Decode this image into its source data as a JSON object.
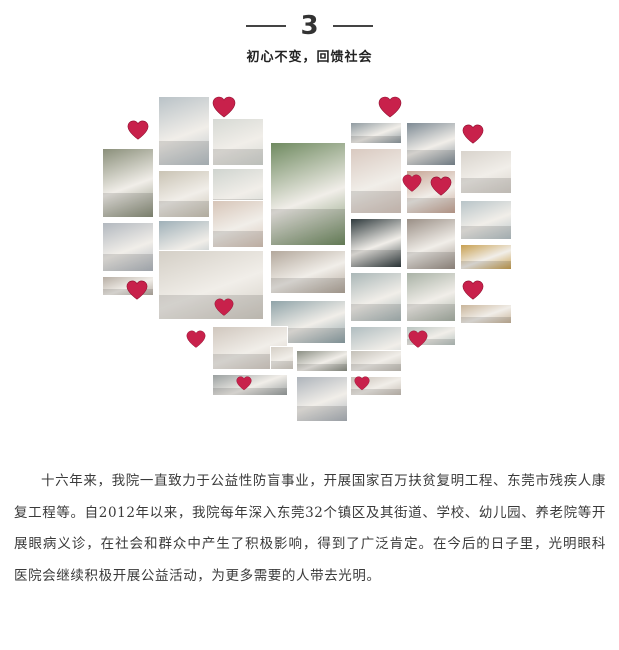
{
  "section": {
    "number": "3",
    "subtitle": "初心不变，回馈社会"
  },
  "collage": {
    "photo_count": 34,
    "heart_count": 14,
    "heart_color": "#c8214b"
  },
  "body_text": "十六年来，我院一直致力于公益性防盲事业，开展国家百万扶贫复明工程、东莞市残疾人康复工程等。自2012年以来，我院每年深入东莞32个镇区及其街道、学校、幼儿园、养老院等开展眼病义诊，在社会和群众中产生了积极影响，得到了广泛肯定。在今后的日子里，光明眼科医院会继续积极开展公益活动，为更多需要的人带去光明。"
}
